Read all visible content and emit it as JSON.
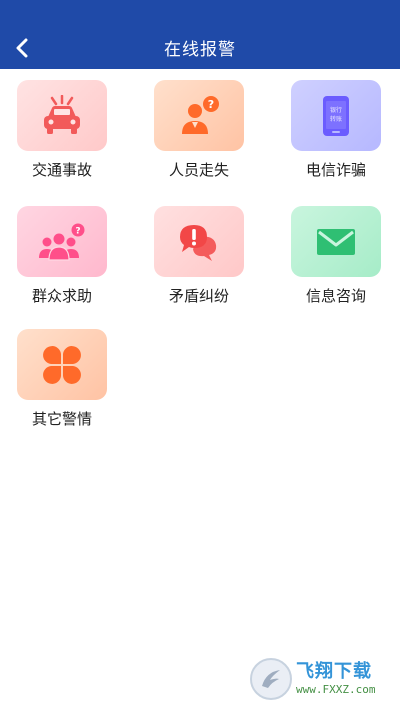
{
  "header": {
    "title": "在线报警"
  },
  "categories": [
    {
      "label": "交通事故",
      "icon": "car-crash-icon",
      "color": "#f25a5a",
      "bg_from": "#ffe3e3",
      "bg_to": "#ffc9c9"
    },
    {
      "label": "人员走失",
      "icon": "person-question-icon",
      "color": "#ff6a2a",
      "bg_from": "#ffe0cc",
      "bg_to": "#ffc3a4"
    },
    {
      "label": "电信诈骗",
      "icon": "phone-icon",
      "color": "#6b5cff",
      "bg_from": "#cfd0ff",
      "bg_to": "#b6b8ff",
      "phone_text_1": "银行",
      "phone_text_2": "转账"
    },
    {
      "label": "群众求助",
      "icon": "group-help-icon",
      "color": "#ff4f8a",
      "bg_from": "#ffd6e2",
      "bg_to": "#ffb8cd"
    },
    {
      "label": "矛盾纠纷",
      "icon": "conflict-chat-icon",
      "color": "#f24747",
      "bg_from": "#ffe0e0",
      "bg_to": "#ffc8c8"
    },
    {
      "label": "信息咨询",
      "icon": "mail-icon",
      "color": "#2fbf73",
      "bg_from": "#c9f5de",
      "bg_to": "#a6ecc8"
    },
    {
      "label": "其它警情",
      "icon": "clover-icon",
      "color": "#ff6a2a",
      "bg_from": "#ffe0cc",
      "bg_to": "#ffc3a4"
    }
  ],
  "watermark": {
    "name": "飞翔下载",
    "url": "www.FXXZ.com"
  }
}
